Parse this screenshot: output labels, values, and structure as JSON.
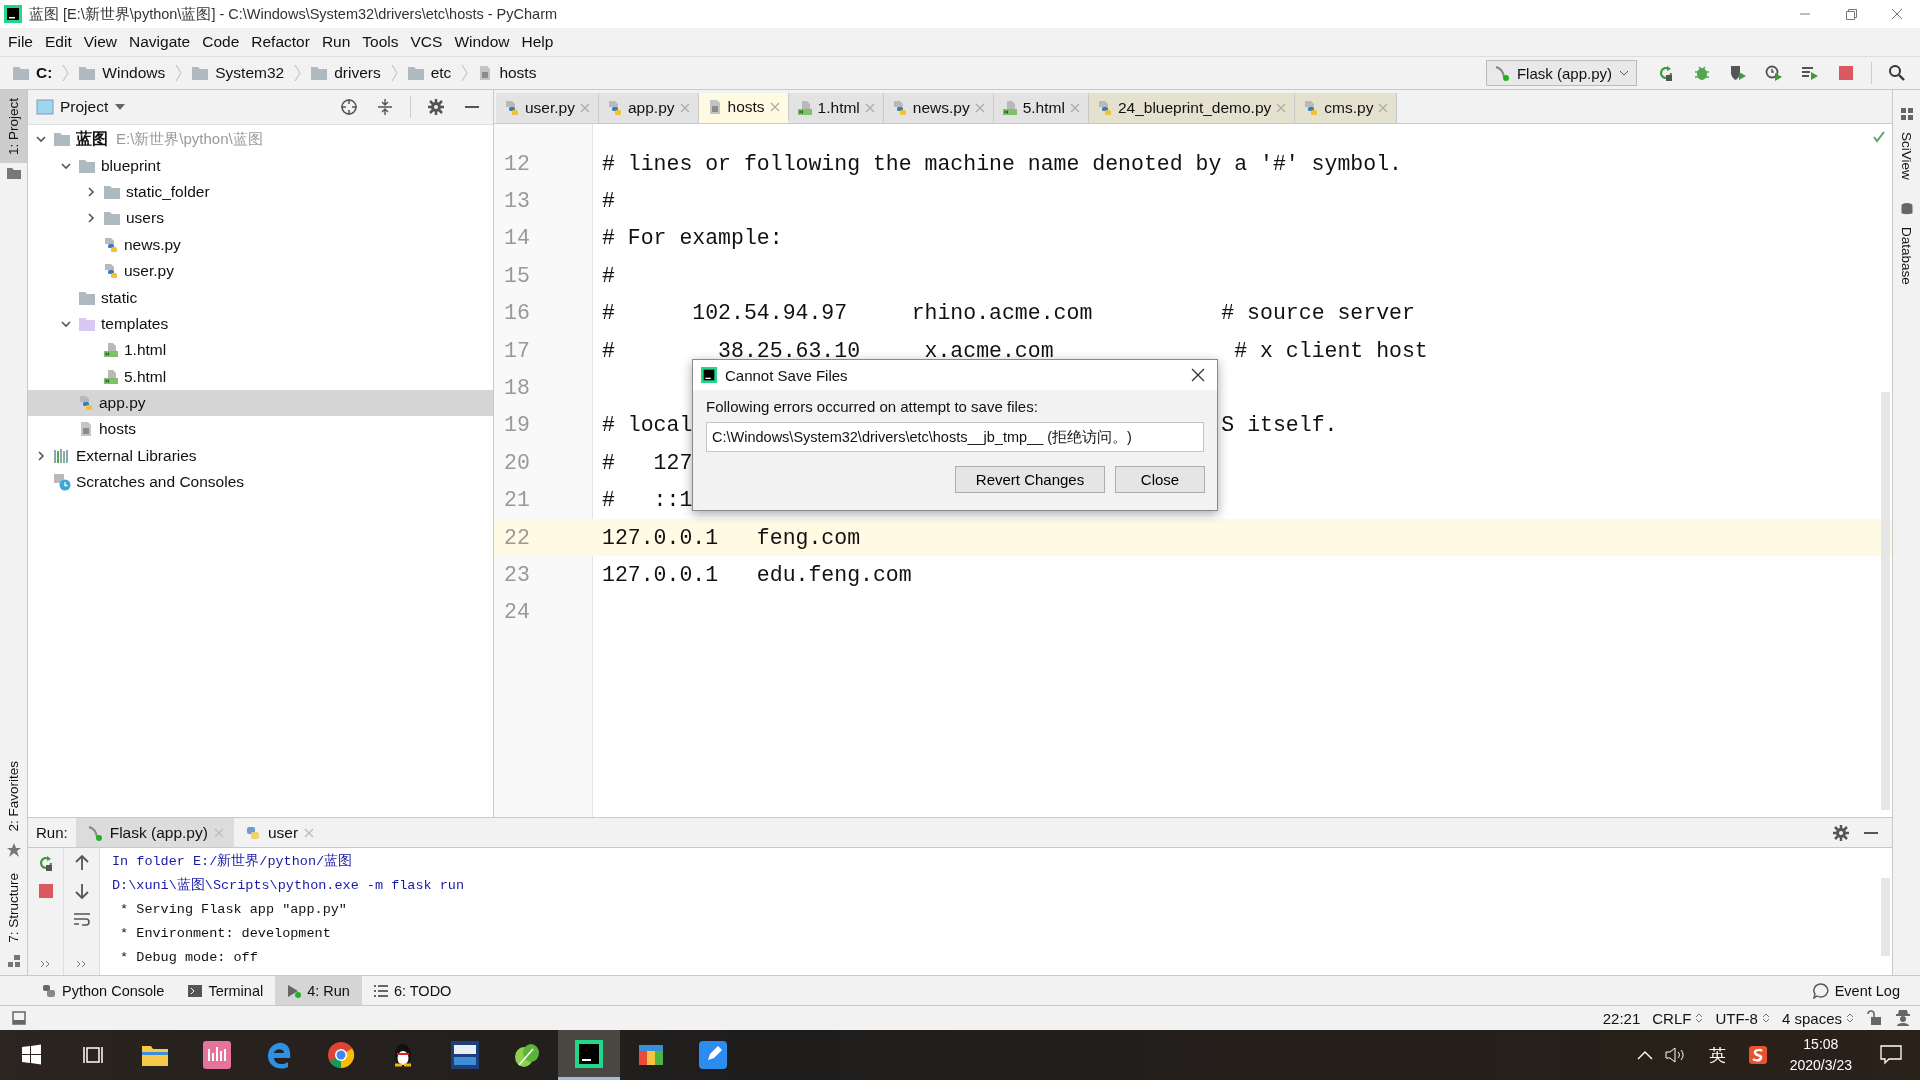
{
  "window": {
    "title": "蓝图 [E:\\新世界\\python\\蓝图] - C:\\Windows\\System32\\drivers\\etc\\hosts - PyCharm"
  },
  "menu": [
    "File",
    "Edit",
    "View",
    "Navigate",
    "Code",
    "Refactor",
    "Run",
    "Tools",
    "VCS",
    "Window",
    "Help"
  ],
  "breadcrumb": [
    {
      "label": "C:",
      "kind": "folder"
    },
    {
      "label": "Windows",
      "kind": "folder"
    },
    {
      "label": "System32",
      "kind": "folder"
    },
    {
      "label": "drivers",
      "kind": "folder"
    },
    {
      "label": "etc",
      "kind": "folder"
    },
    {
      "label": "hosts",
      "kind": "text"
    }
  ],
  "run_config": {
    "label": "Flask (app.py)"
  },
  "left_stripe": [
    {
      "label": "1: Project",
      "selected": true
    },
    {
      "label": "2: Favorites",
      "selected": false
    },
    {
      "label": "7: Structure",
      "selected": false
    }
  ],
  "right_stripe": [
    {
      "label": "SciView"
    },
    {
      "label": "Database"
    }
  ],
  "project": {
    "title": "Project",
    "tree": [
      {
        "label": "蓝图",
        "path": "E:\\新世界\\python\\蓝图",
        "kind": "folder",
        "expanded": true,
        "selected": false,
        "children": [
          {
            "label": "blueprint",
            "kind": "folder",
            "expanded": true,
            "selected": false,
            "children": [
              {
                "label": "static_folder",
                "kind": "folder",
                "expanded": false,
                "selected": false
              },
              {
                "label": "users",
                "kind": "folder",
                "expanded": false,
                "selected": false
              },
              {
                "label": "news.py",
                "kind": "python",
                "selected": false
              },
              {
                "label": "user.py",
                "kind": "python",
                "selected": false
              }
            ]
          },
          {
            "label": "static",
            "kind": "folder",
            "selected": false
          },
          {
            "label": "templates",
            "kind": "templates",
            "expanded": true,
            "selected": false,
            "children": [
              {
                "label": "1.html",
                "kind": "html",
                "selected": false
              },
              {
                "label": "5.html",
                "kind": "html",
                "selected": false
              }
            ]
          },
          {
            "label": "app.py",
            "kind": "python",
            "selected": true
          },
          {
            "label": "hosts",
            "kind": "text",
            "selected": false
          }
        ]
      },
      {
        "label": "External Libraries",
        "kind": "libraries",
        "expanded": false,
        "selected": false
      },
      {
        "label": "Scratches and Consoles",
        "kind": "scratches",
        "selected": false
      }
    ]
  },
  "editor": {
    "tabs": [
      {
        "label": "user.py",
        "kind": "python",
        "selected": false,
        "color": "#e3e3e3"
      },
      {
        "label": "app.py",
        "kind": "python",
        "selected": false,
        "color": "#e3e3e3"
      },
      {
        "label": "hosts",
        "kind": "text",
        "selected": true,
        "color": "#fffbe3"
      },
      {
        "label": "1.html",
        "kind": "html",
        "selected": false,
        "color": "#e3e3e3"
      },
      {
        "label": "news.py",
        "kind": "python",
        "selected": false,
        "color": "#e3e3e3"
      },
      {
        "label": "5.html",
        "kind": "html",
        "selected": false,
        "color": "#e3e3e3"
      },
      {
        "label": "24_blueprint_demo.py",
        "kind": "python",
        "selected": false,
        "color": "#e4e2cf"
      },
      {
        "label": "cms.py",
        "kind": "python",
        "selected": false,
        "color": "#e4e2cf"
      }
    ],
    "lines": [
      {
        "number": "12",
        "text": "# lines or following the machine name denoted by a '#' symbol.",
        "current": false
      },
      {
        "number": "13",
        "text": "#",
        "current": false
      },
      {
        "number": "14",
        "text": "# For example:",
        "current": false
      },
      {
        "number": "15",
        "text": "#",
        "current": false
      },
      {
        "number": "16",
        "text": "#      102.54.94.97     rhino.acme.com          # source server",
        "current": false
      },
      {
        "number": "17",
        "text": "#        38.25.63.10     x.acme.com              # x client host",
        "current": false
      },
      {
        "number": "18",
        "current": false
      },
      {
        "number": "19",
        "text": "# local                                         S itself.",
        "current": false
      },
      {
        "number": "20",
        "text": "#   127",
        "current": false
      },
      {
        "number": "21",
        "text": "#   ::1",
        "current": false
      },
      {
        "number": "22",
        "text": "127.0.0.1   feng.com",
        "current": true
      },
      {
        "number": "23",
        "text": "127.0.0.1   edu.feng.com",
        "current": false
      },
      {
        "number": "24",
        "current": false
      }
    ]
  },
  "dialog": {
    "title": "Cannot Save Files",
    "message": "Following errors occurred on attempt to save files:",
    "path": "C:\\Windows\\System32\\drivers\\etc\\hosts__jb_tmp__ (拒绝访问。)",
    "buttons": [
      "Revert Changes",
      "Close"
    ]
  },
  "run": {
    "label": "Run:",
    "tabs": [
      {
        "label": "Flask (app.py)",
        "kind": "flask",
        "selected": true
      },
      {
        "label": "user",
        "kind": "python",
        "selected": false
      }
    ],
    "console": [
      {
        "text": "In folder E:/新世界/python/蓝图",
        "kind": "system"
      },
      {
        "text": "D:\\xuni\\蓝图\\Scripts\\python.exe -m flask run",
        "kind": "system"
      },
      {
        "text": " * Serving Flask app \"app.py\"",
        "kind": "stdout"
      },
      {
        "text": " * Environment: development",
        "kind": "stdout"
      },
      {
        "text": " * Debug mode: off",
        "kind": "stdout"
      }
    ]
  },
  "tool_windows": [
    {
      "label": "Python Console",
      "kind": "python",
      "selected": false
    },
    {
      "label": "Terminal",
      "kind": "terminal",
      "selected": false
    },
    {
      "label": "4: Run",
      "kind": "run",
      "selected": true
    },
    {
      "label": "6: TODO",
      "kind": "todo",
      "selected": false
    }
  ],
  "event_log": "Event Log",
  "status_bar": {
    "position": "22:21",
    "line_separator": "CRLF",
    "encoding": "UTF-8",
    "indent": "4 spaces"
  },
  "taskbar": {
    "apps": [
      {
        "kind": "explorer",
        "active": false
      },
      {
        "kind": "music",
        "active": false
      },
      {
        "kind": "edge",
        "active": false
      },
      {
        "kind": "chrome",
        "active": false
      },
      {
        "kind": "penguin",
        "active": false
      },
      {
        "kind": "dev",
        "active": false
      },
      {
        "kind": "leaf",
        "active": false
      },
      {
        "kind": "pycharm",
        "active": true
      },
      {
        "kind": "store",
        "active": false
      },
      {
        "kind": "notes",
        "active": false
      }
    ],
    "ime": "英",
    "time": "15:08",
    "date": "2020/3/23"
  }
}
